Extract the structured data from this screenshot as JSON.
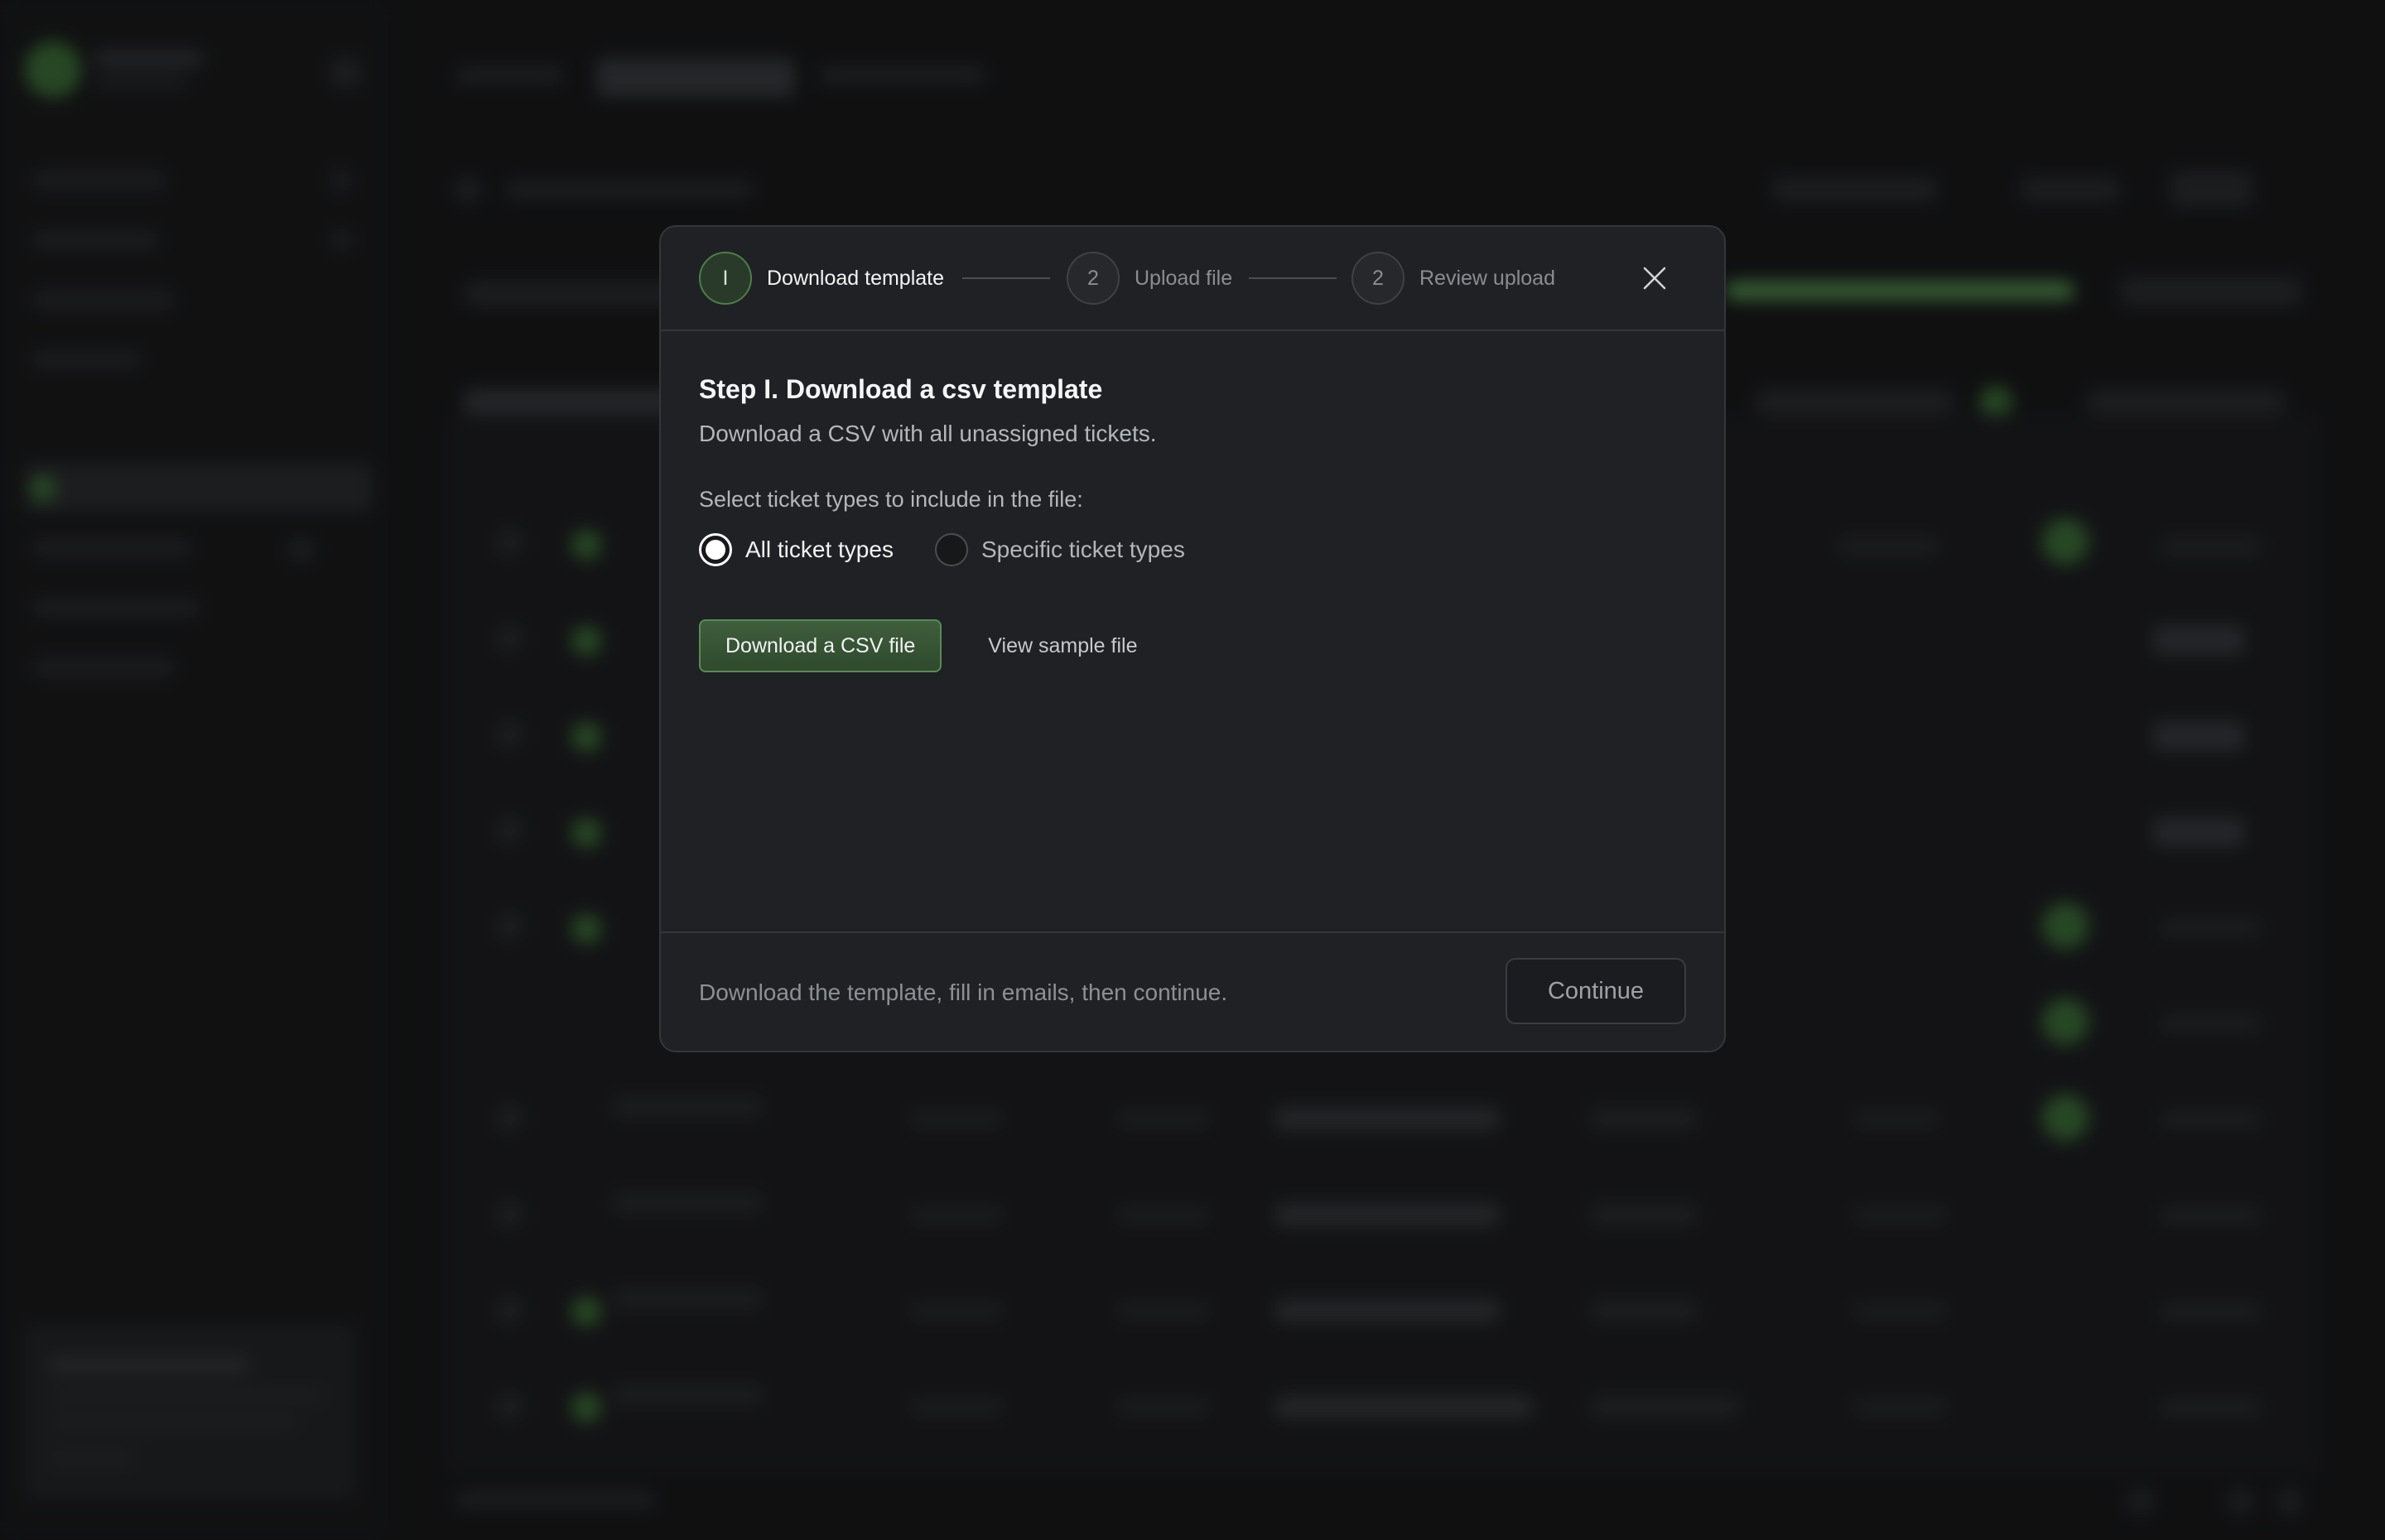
{
  "stepper": {
    "steps": [
      {
        "number": "I",
        "label": "Download template"
      },
      {
        "number": "2",
        "label": "Upload file"
      },
      {
        "number": "2",
        "label": "Review upload"
      }
    ]
  },
  "content": {
    "title": "Step I. Download a csv template",
    "subtitle": "Download a CSV with all unassigned tickets.",
    "select_label": "Select ticket types to include in the file:",
    "radio_options": [
      {
        "label": "All ticket types",
        "selected": true
      },
      {
        "label": "Specific ticket types",
        "selected": false
      }
    ],
    "download_button": "Download a CSV file",
    "sample_link": "View sample file"
  },
  "footer": {
    "hint": "Download the template, fill in emails, then continue.",
    "continue_label": "Continue"
  },
  "colors": {
    "accent": "#5da657",
    "modal_bg": "#202124",
    "page_bg": "#141517"
  }
}
